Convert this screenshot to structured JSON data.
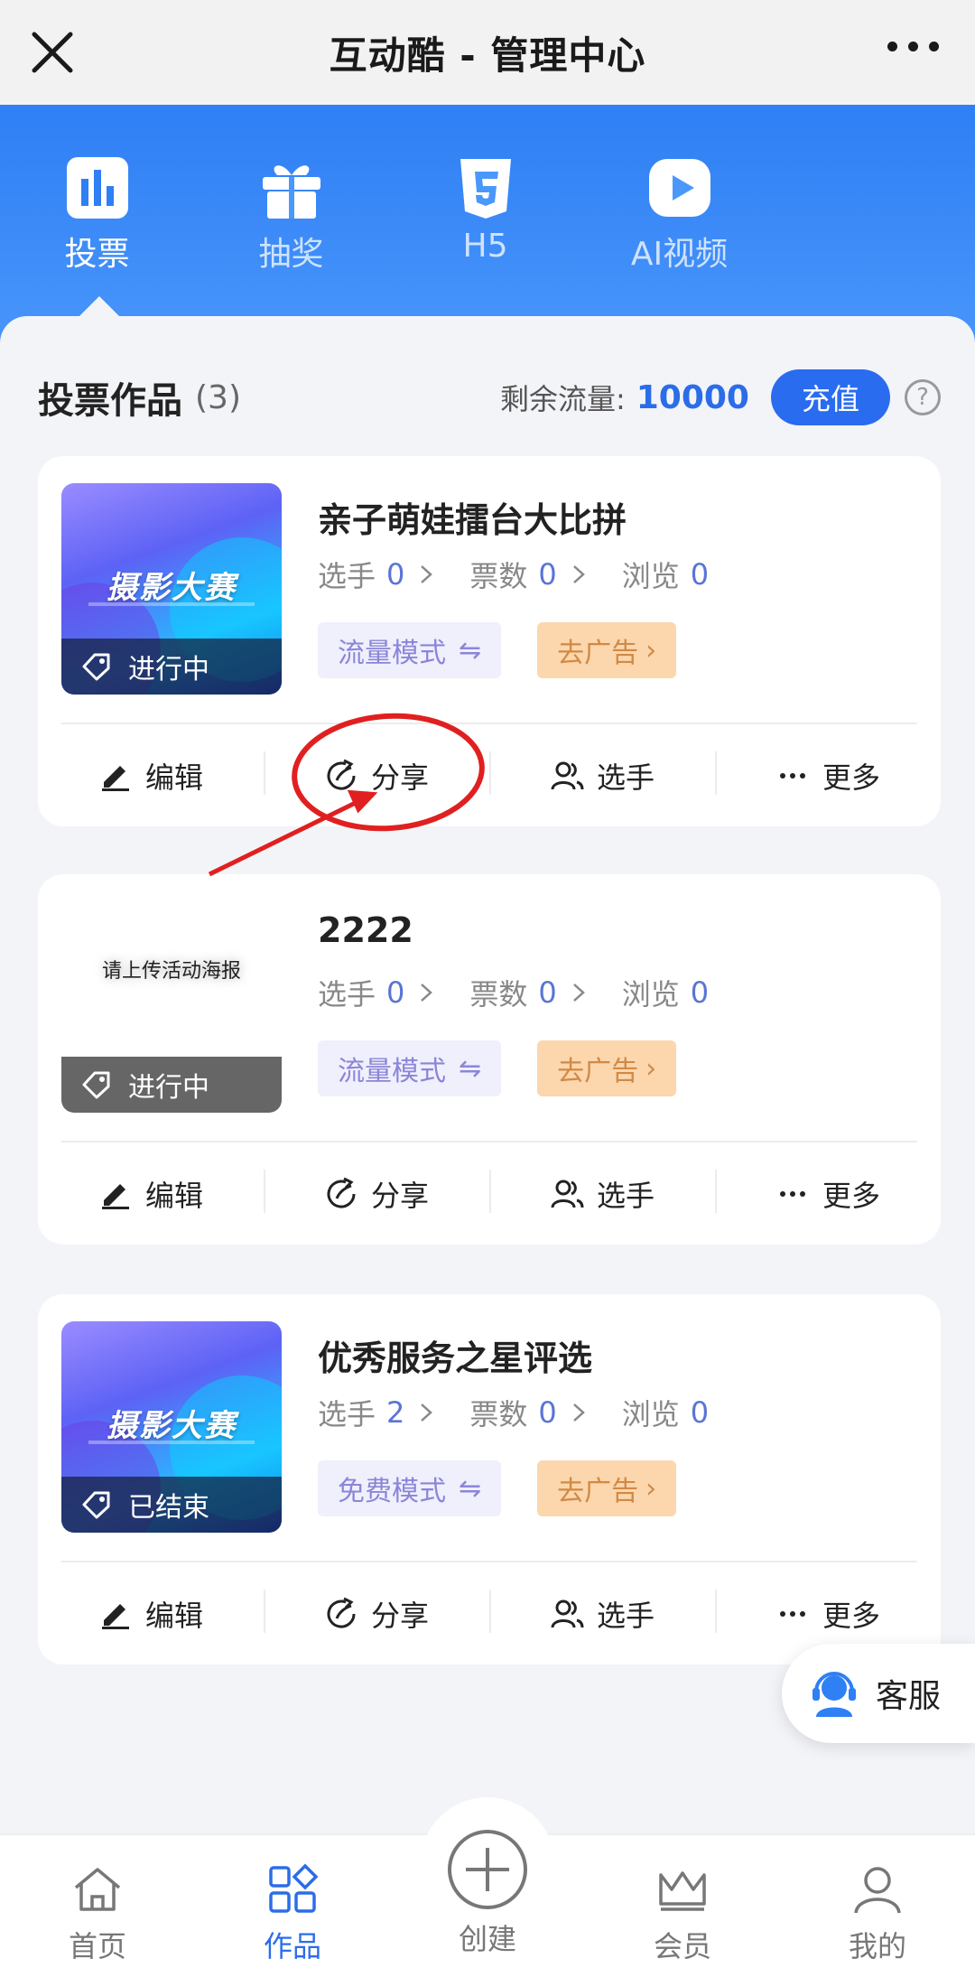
{
  "topbar": {
    "title": "互动酷 - 管理中心"
  },
  "navtabs": [
    {
      "label": "投票",
      "icon": "bar-chart-icon",
      "active": true
    },
    {
      "label": "抽奖",
      "icon": "gift-icon",
      "active": false
    },
    {
      "label": "H5",
      "icon": "html5-icon",
      "active": false
    },
    {
      "label": "AI视频",
      "icon": "play-video-icon",
      "active": false
    }
  ],
  "summary": {
    "heading": "投票作品",
    "count": "(3)",
    "flow_label": "剩余流量:",
    "flow_value": "10000",
    "recharge": "充值",
    "help": "?"
  },
  "cards": [
    {
      "title": "亲子萌娃擂台大比拼",
      "poster_text": "摄影大赛",
      "status": "进行中",
      "players_label": "选手",
      "players": "0",
      "votes_label": "票数",
      "votes": "0",
      "views_label": "浏览",
      "views": "0",
      "mode": "流量模式",
      "ad": "去广告",
      "actions": [
        "编辑",
        "分享",
        "选手",
        "更多"
      ]
    },
    {
      "title": "2222",
      "poster_placeholder": "请上传活动海报",
      "status": "进行中",
      "players_label": "选手",
      "players": "0",
      "votes_label": "票数",
      "votes": "0",
      "views_label": "浏览",
      "views": "0",
      "mode": "流量模式",
      "ad": "去广告",
      "actions": [
        "编辑",
        "分享",
        "选手",
        "更多"
      ]
    },
    {
      "title": "优秀服务之星评选",
      "poster_text": "摄影大赛",
      "status": "已结束",
      "players_label": "选手",
      "players": "2",
      "votes_label": "票数",
      "votes": "0",
      "views_label": "浏览",
      "views": "0",
      "mode": "免费模式",
      "ad": "去广告",
      "actions": [
        "编辑",
        "分享",
        "选手",
        "更多"
      ]
    }
  ],
  "service": {
    "label": "客服"
  },
  "bottomnav": [
    {
      "label": "首页",
      "icon": "home-icon",
      "active": false
    },
    {
      "label": "作品",
      "icon": "works-grid-icon",
      "active": true
    },
    {
      "label": "创建",
      "icon": "plus-circle-icon",
      "active": false
    },
    {
      "label": "会员",
      "icon": "crown-icon",
      "active": false
    },
    {
      "label": "我的",
      "icon": "user-icon",
      "active": false
    }
  ],
  "colors": {
    "primary": "#2a6cf0",
    "annotation": "#e02020",
    "ad_chip": "#fcd6ad",
    "mode_chip": "#f0effc"
  }
}
